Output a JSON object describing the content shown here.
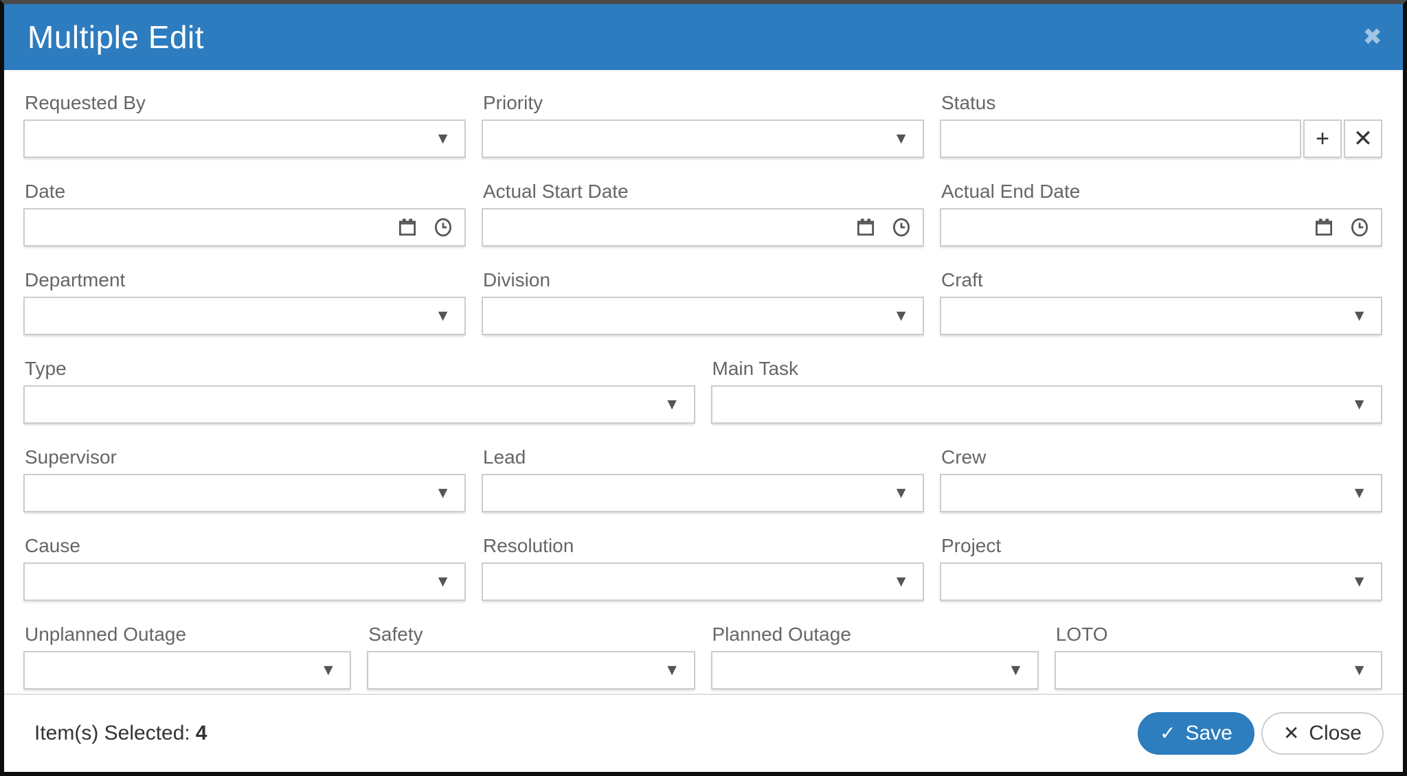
{
  "header": {
    "title": "Multiple Edit",
    "close_icon": "✖"
  },
  "form": {
    "requested_by": {
      "label": "Requested By",
      "value": ""
    },
    "priority": {
      "label": "Priority",
      "value": ""
    },
    "status": {
      "label": "Status",
      "value": "",
      "add_icon": "+",
      "clear_icon": "✕"
    },
    "date": {
      "label": "Date",
      "value": ""
    },
    "actual_start_date": {
      "label": "Actual Start Date",
      "value": ""
    },
    "actual_end_date": {
      "label": "Actual End Date",
      "value": ""
    },
    "department": {
      "label": "Department",
      "value": ""
    },
    "division": {
      "label": "Division",
      "value": ""
    },
    "craft": {
      "label": "Craft",
      "value": ""
    },
    "type": {
      "label": "Type",
      "value": ""
    },
    "main_task": {
      "label": "Main Task",
      "value": ""
    },
    "supervisor": {
      "label": "Supervisor",
      "value": ""
    },
    "lead": {
      "label": "Lead",
      "value": ""
    },
    "crew": {
      "label": "Crew",
      "value": ""
    },
    "cause": {
      "label": "Cause",
      "value": ""
    },
    "resolution": {
      "label": "Resolution",
      "value": ""
    },
    "project": {
      "label": "Project",
      "value": ""
    },
    "unplanned_outage": {
      "label": "Unplanned Outage",
      "value": ""
    },
    "safety": {
      "label": "Safety",
      "value": ""
    },
    "planned_outage": {
      "label": "Planned Outage",
      "value": ""
    },
    "loto": {
      "label": "LOTO",
      "value": ""
    }
  },
  "icons": {
    "dropdown_arrow": "▼",
    "calendar": "calendar-icon",
    "clock": "clock-icon"
  },
  "footer": {
    "selected_label": "Item(s) Selected:",
    "selected_count": "4",
    "save": {
      "icon": "✓",
      "label": "Save"
    },
    "close": {
      "icon": "✕",
      "label": "Close"
    }
  },
  "colors": {
    "header_blue": "#2d7cbf",
    "save_blue": "#2d7dbf",
    "field_border": "#cccccc",
    "label_gray": "#666666",
    "text_dark": "#333333"
  }
}
